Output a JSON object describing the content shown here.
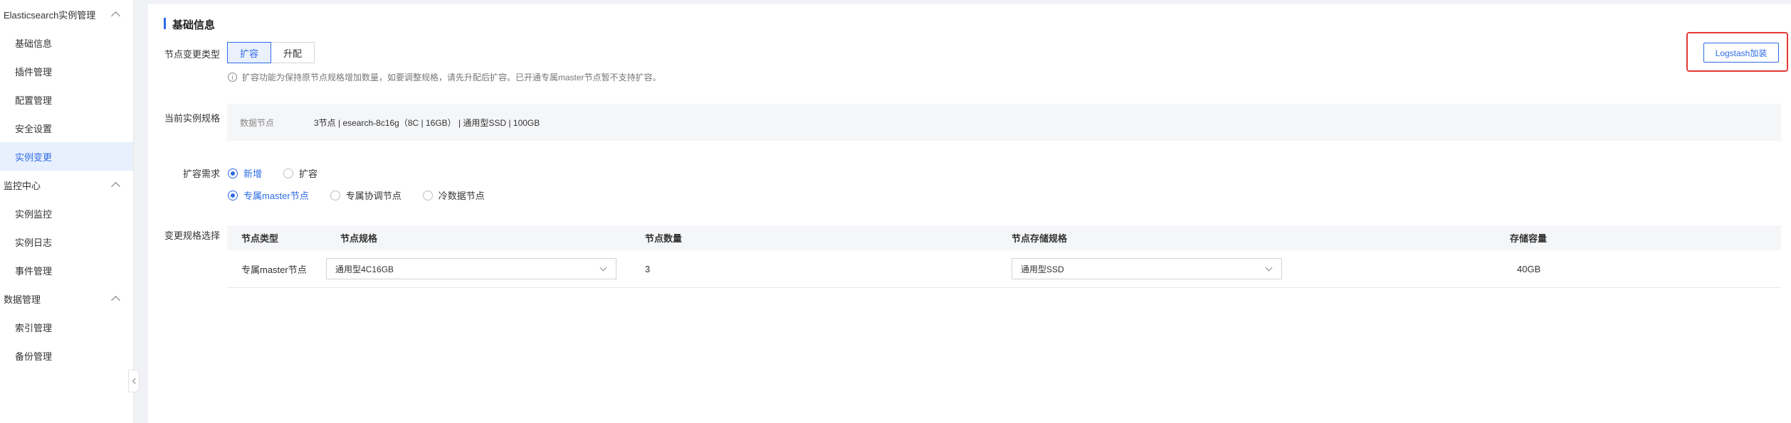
{
  "sidebar": {
    "groups": [
      {
        "label": "Elasticsearch实例管理",
        "items": [
          "基础信息",
          "插件管理",
          "配置管理",
          "安全设置",
          "实例变更"
        ]
      },
      {
        "label": "监控中心",
        "items": [
          "实例监控",
          "实例日志",
          "事件管理"
        ]
      },
      {
        "label": "数据管理",
        "items": [
          "索引管理",
          "备份管理"
        ]
      }
    ],
    "active_item": "实例变更"
  },
  "section": {
    "title": "基础信息"
  },
  "change_type": {
    "label": "节点变更类型",
    "options": [
      "扩容",
      "升配"
    ],
    "selected": "扩容",
    "hint": "扩容功能为保持原节点规格增加数量，如要调整规格，请先升配后扩容。已开通专属master节点暂不支持扩容。"
  },
  "logstash_button": {
    "label": "Logstash加装"
  },
  "current_spec": {
    "label": "当前实例规格",
    "key": "数据节点",
    "value": "3节点 | esearch-8c16g（8C | 16GB） | 通用型SSD | 100GB"
  },
  "expand_demand": {
    "label": "扩容需求",
    "options": [
      "新增",
      "扩容"
    ],
    "selected": "新增",
    "node_options": [
      "专属master节点",
      "专属协调节点",
      "冷数据节点"
    ],
    "node_selected": "专属master节点"
  },
  "spec_table": {
    "label": "变更规格选择",
    "headers": [
      "节点类型",
      "节点规格",
      "节点数量",
      "节点存储规格",
      "存储容量"
    ],
    "rows": [
      {
        "type": "专属master节点",
        "spec": "通用型4C16GB",
        "count": "3",
        "storage": "通用型SSD",
        "capacity": "40GB"
      }
    ]
  },
  "colors": {
    "accent": "#2e6be6",
    "highlight": "#e53935"
  }
}
